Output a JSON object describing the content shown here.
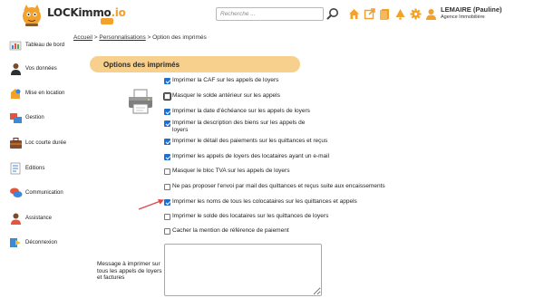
{
  "header": {
    "logo_text": "LOCKimmo",
    "logo_suffix": ".io",
    "search_placeholder": "Recherche ...",
    "user_name": "LEMAIRE (Pauline)",
    "user_agency": "Agence Immobilière",
    "icons": [
      "home-icon",
      "external-link-icon",
      "document-icon",
      "bell-icon",
      "gear-icon",
      "user-icon"
    ],
    "accent_color": "#f2a12b"
  },
  "sidebar": {
    "items": [
      {
        "label": "Tableau de bord",
        "icon": "dashboard-icon"
      },
      {
        "label": "Vos données",
        "icon": "person-icon"
      },
      {
        "label": "Mise en location",
        "icon": "rental-icon"
      },
      {
        "label": "Gestion",
        "icon": "management-icon"
      },
      {
        "label": "Loc courte durée",
        "icon": "suitcase-icon"
      },
      {
        "label": "Editions",
        "icon": "editions-icon"
      },
      {
        "label": "Communication",
        "icon": "chat-icon"
      },
      {
        "label": "Assistance",
        "icon": "support-icon"
      },
      {
        "label": "Déconnexion",
        "icon": "logout-icon"
      }
    ]
  },
  "breadcrumb": {
    "home": "Accueil",
    "sep1": ">",
    "parent": "Personnalisations",
    "sep2": ">",
    "current": "Option des imprimés"
  },
  "section": {
    "title": "Options des imprimés"
  },
  "options": [
    {
      "label": "Imprimer la CAF sur les appels de loyers",
      "checked": true
    },
    {
      "label": "Masquer le solde antérieur sur les appels",
      "checked": false,
      "focused": true
    },
    {
      "label": "Imprimer la date d'échéance sur les appels de loyers",
      "checked": true
    },
    {
      "label": "Imprimer la description des biens sur les appels de loyers",
      "checked": true
    },
    {
      "label": "Imprimer le détail des paiements sur les quittances et reçus",
      "checked": true
    },
    {
      "label": "Imprimer les appels de loyers des locataires ayant un e-mail",
      "checked": true
    },
    {
      "label": "Masquer le bloc TVA sur les appels de loyers",
      "checked": false
    },
    {
      "label": "Ne pas proposer l'envoi par mail des quittances et reçus suite aux encaissements",
      "checked": false
    },
    {
      "label": "Imprimer les noms de tous les colocataires sur les quittances et appels",
      "checked": true,
      "highlighted": true
    },
    {
      "label": "Imprimer le solde des locataires sur les quittances de loyers",
      "checked": false
    },
    {
      "label": "Cacher la mention de référence de paiement",
      "checked": false
    }
  ],
  "message": {
    "label": "Message à imprimer sur tous les appels de loyers et factures",
    "value": ""
  },
  "annotation_arrow_color": "#e0464b"
}
